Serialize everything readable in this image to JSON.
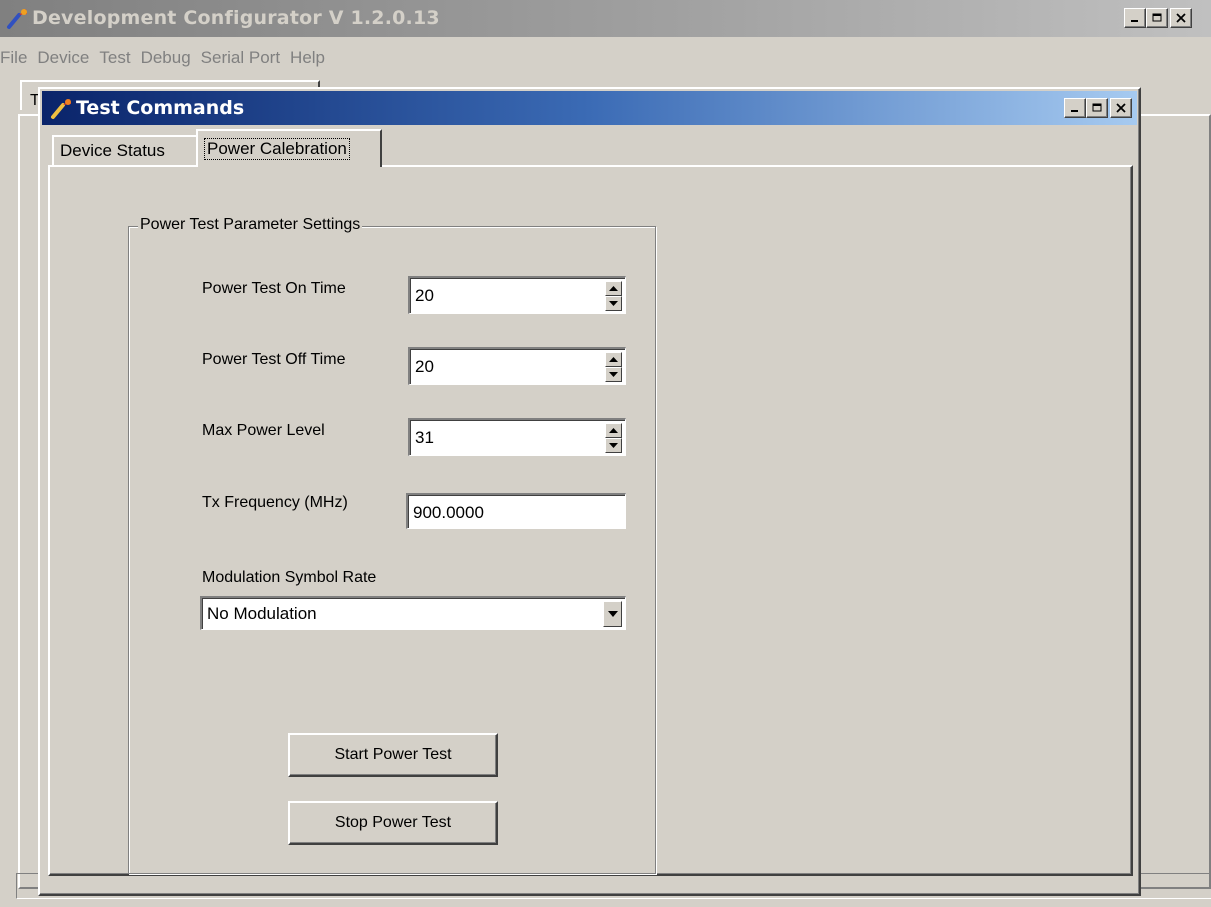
{
  "main_window": {
    "title": "Development Configurator V 1.2.0.13",
    "menu": [
      "File",
      "Device",
      "Test",
      "Debug",
      "Serial Port",
      "Help"
    ],
    "background_tab_label": "T"
  },
  "child_window": {
    "title": "Test Commands",
    "tabs": [
      {
        "label": "Device Status",
        "active": false
      },
      {
        "label": "Power Calebration",
        "active": true
      }
    ],
    "groupbox_title": "Power Test Parameter Settings",
    "fields": {
      "on_time": {
        "label": "Power Test On Time",
        "value": "20"
      },
      "off_time": {
        "label": "Power Test Off Time",
        "value": "20"
      },
      "max_power": {
        "label": "Max Power Level",
        "value": "31"
      },
      "tx_freq": {
        "label": "Tx Frequency (MHz)",
        "value": "900.0000"
      }
    },
    "modulation": {
      "label": "Modulation Symbol Rate",
      "selected": "No Modulation"
    },
    "buttons": {
      "start": "Start Power Test",
      "stop": "Stop Power Test"
    }
  },
  "colors": {
    "face": "#d4d0c8",
    "active_title_start": "#0a246a",
    "active_title_end": "#a6caf0",
    "inactive_title": "#808080"
  },
  "icons": [
    "app-icon",
    "minimize-icon",
    "maximize-icon",
    "close-icon",
    "spin-up-icon",
    "spin-down-icon",
    "dropdown-arrow-icon"
  ]
}
